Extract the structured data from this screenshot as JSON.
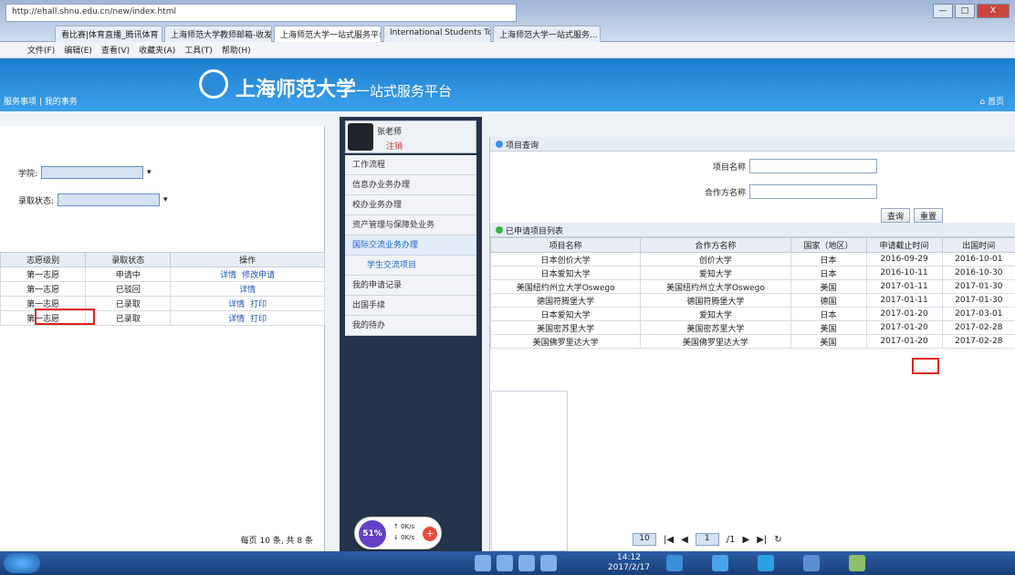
{
  "browser": {
    "address": "http://ehall.shnu.edu.cn/new/index.html",
    "tabs": [
      "看比赛|体育直播_腾讯体育",
      "上海师范大学教师邮箱-收发",
      "上海师范大学一站式服务平台",
      "International Students Toky",
      "上海师范大学一站式服务..."
    ],
    "controls": [
      "—",
      "□",
      "X"
    ]
  },
  "menubar": [
    "文件(F)",
    "编辑(E)",
    "查看(V)",
    "收藏夹(A)",
    "工具(T)",
    "帮助(H)"
  ],
  "header": {
    "title": "上海师范大学",
    "subtitle": "一站式服务平台",
    "left_link": "服务事项 | 我的事务",
    "home_link": "首页"
  },
  "left_panel": {
    "field1_label": "学院:",
    "field1_value": "",
    "field2_label": "录取状态:",
    "field2_value": "",
    "table_headers": [
      "志愿级别",
      "录取状态",
      "操作"
    ],
    "rows": [
      {
        "level": "第一志愿",
        "status": "申请中",
        "ops": [
          "详情",
          "修改申请"
        ]
      },
      {
        "level": "第一志愿",
        "status": "已驳回",
        "ops": [
          "详情"
        ]
      },
      {
        "level": "第一志愿",
        "status": "已录取",
        "ops": [
          "详情",
          "打印"
        ]
      },
      {
        "level": "第一志愿",
        "status": "已录取",
        "ops": [
          "详情",
          "打印"
        ]
      }
    ],
    "pager": "每页 10 条, 共 8 条"
  },
  "nav": {
    "username": "张老师",
    "logout": "注销",
    "items": [
      "工作流程",
      "信息办业务办理",
      "校办业务办理",
      "资产管理与保障处业务",
      "国际交流业务办理",
      "学生交流项目",
      "我的申请记录",
      "出国手续",
      "我的待办"
    ]
  },
  "right_panel": {
    "query_title": "项目查询",
    "field_project": "项目名称",
    "field_partner": "合作方名称",
    "btn_query": "查询",
    "btn_reset": "重置",
    "list_title": "已申请项目列表",
    "table_headers": [
      "项目名称",
      "合作方名称",
      "国家（地区）",
      "申请截止时间",
      "出国时间"
    ],
    "rows": [
      {
        "name": "日本创价大学",
        "partner": "创价大学",
        "country": "日本",
        "deadline": "2016-09-29",
        "depart": "2016-10-01"
      },
      {
        "name": "日本爱知大学",
        "partner": "爱知大学",
        "country": "日本",
        "deadline": "2016-10-11",
        "depart": "2016-10-30"
      },
      {
        "name": "美国纽约州立大学Oswego",
        "partner": "美国纽约州立大学Oswego",
        "country": "美国",
        "deadline": "2017-01-11",
        "depart": "2017-01-30"
      },
      {
        "name": "德国符腾堡大学",
        "partner": "德国符腾堡大学",
        "country": "德国",
        "deadline": "2017-01-11",
        "depart": "2017-01-30"
      },
      {
        "name": "日本爱知大学",
        "partner": "爱知大学",
        "country": "日本",
        "deadline": "2017-01-20",
        "depart": "2017-03-01"
      },
      {
        "name": "美国密苏里大学",
        "partner": "美国密苏里大学",
        "country": "美国",
        "deadline": "2017-01-20",
        "depart": "2017-02-28"
      },
      {
        "name": "美国佛罗里达大学",
        "partner": "美国佛罗里达大学",
        "country": "美国",
        "deadline": "2017-01-20",
        "depart": "2017-02-28"
      }
    ],
    "pager_size": "10",
    "pager_page": "1",
    "pager_total": "/1"
  },
  "widget": {
    "percent": "51%",
    "up": "0K/s",
    "down": "0K/s"
  },
  "taskbar": {
    "time": "14:12",
    "date": "2017/2/17"
  }
}
